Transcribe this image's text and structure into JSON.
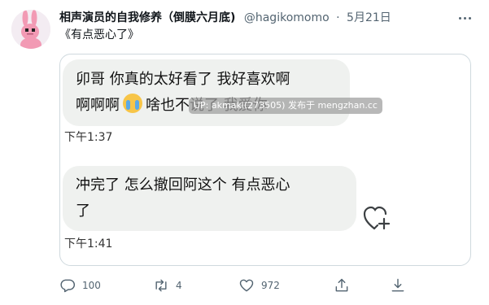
{
  "tweet": {
    "author": {
      "display_name": "相声演员的自我修养（倒膜六月底)",
      "handle": "@hagikomomo",
      "separator": "·",
      "date": "5月21日"
    },
    "text": "《有点恶心了》",
    "media": {
      "messages": [
        {
          "lines": [
            "卯哥 你真的太好看了 我好喜欢啊",
            "啊啊啊",
            "啥也不说了 我爱你"
          ],
          "emoji": "loudly-crying-face",
          "time": "下午1:37"
        },
        {
          "lines": [
            "冲完了 怎么撤回阿这个 有点恶心",
            "了"
          ],
          "time": "下午1:41"
        }
      ],
      "watermark": "UP: akmaki(273505) 发布于 mengzhan.cc"
    },
    "actions": {
      "replies": "100",
      "retweets": "4",
      "likes": "972"
    }
  },
  "colors": {
    "text_primary": "#0f1419",
    "text_secondary": "#536471",
    "bubble": "#eff1ef",
    "border": "#cfd9de",
    "avatar_pink": "#f29ab4"
  }
}
